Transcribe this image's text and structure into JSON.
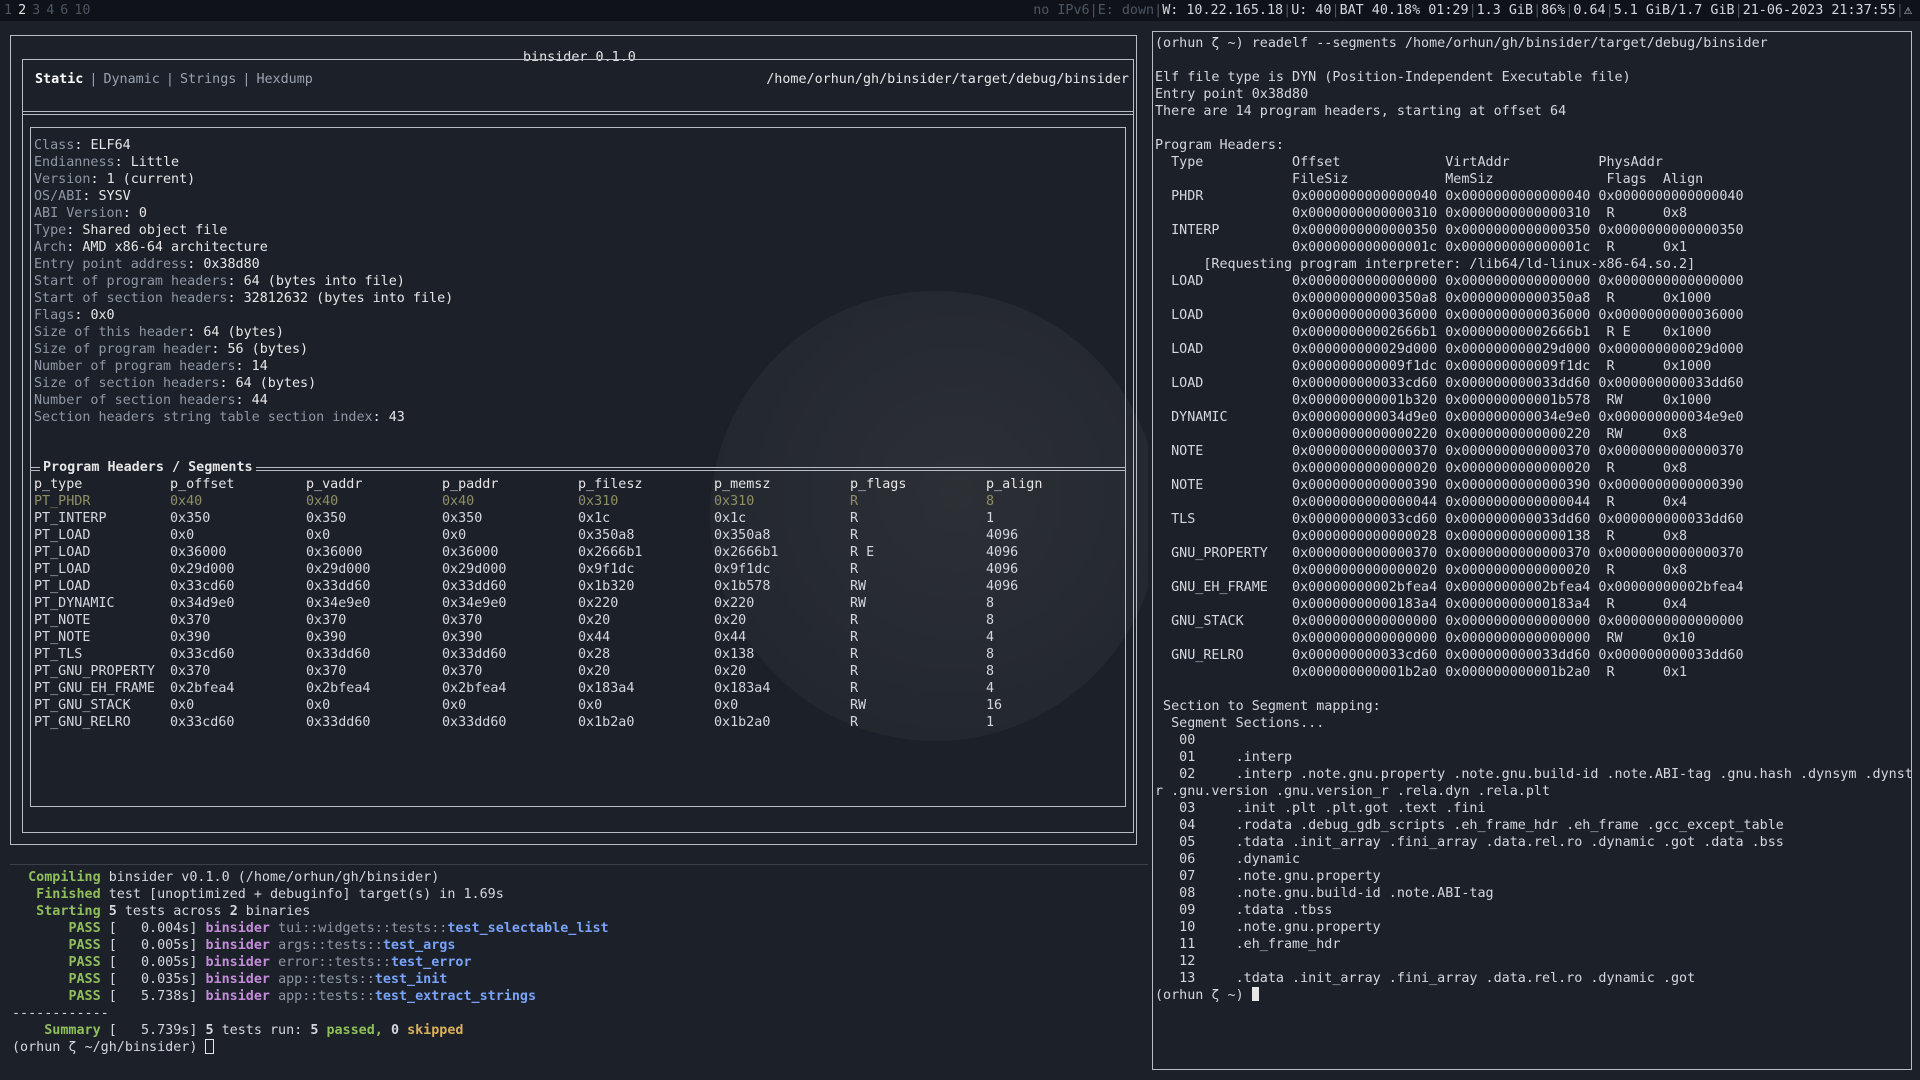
{
  "topbar": {
    "workspaces": [
      "1",
      "2",
      "3",
      "4",
      "6",
      "10"
    ],
    "active_workspace": "2",
    "status_dim": "no IPv6",
    "status_eth": "E: down",
    "status_wifi": "W: 10.22.165.18",
    "status_user": "U: 40",
    "status_bat": "BAT 40.18% 01:29",
    "status_disk": "1.3 GiB",
    "status_cpu": "86%",
    "status_load": "0.64",
    "status_mem": "5.1 GiB/1.7 GiB",
    "status_time": "21-06-2023 21:37:55",
    "status_end": "⚠"
  },
  "app": {
    "title": "binsider 0.1.0",
    "tabs": [
      "Static",
      "Dynamic",
      "Strings",
      "Hexdump"
    ],
    "active_tab": "Static",
    "path": "/home/orhun/gh/binsider/target/debug/binsider"
  },
  "header_info": [
    {
      "k": "Class",
      "v": "ELF64"
    },
    {
      "k": "Endianness",
      "v": "Little"
    },
    {
      "k": "Version",
      "v": "1 (current)"
    },
    {
      "k": "OS/ABI",
      "v": "SYSV"
    },
    {
      "k": "ABI Version",
      "v": "0"
    },
    {
      "k": "Type",
      "v": "Shared object file"
    },
    {
      "k": "Arch",
      "v": "AMD x86-64 architecture"
    },
    {
      "k": "Entry point address",
      "v": "0x38d80"
    },
    {
      "k": "Start of program headers",
      "v": "64 (bytes into file)"
    },
    {
      "k": "Start of section headers",
      "v": "32812632 (bytes into file)"
    },
    {
      "k": "Flags",
      "v": "0x0"
    },
    {
      "k": "Size of this header",
      "v": "64 (bytes)"
    },
    {
      "k": "Size of program header",
      "v": "56 (bytes)"
    },
    {
      "k": "Number of program headers",
      "v": "14"
    },
    {
      "k": "Size of section headers",
      "v": "64 (bytes)"
    },
    {
      "k": "Number of section headers",
      "v": "44"
    },
    {
      "k": "Section headers string table section index",
      "v": "43"
    }
  ],
  "program_headers": {
    "title": "Program Headers / Segments",
    "columns": [
      "p_type",
      "p_offset",
      "p_vaddr",
      "p_paddr",
      "p_filesz",
      "p_memsz",
      "p_flags",
      "p_align"
    ],
    "rows": [
      [
        "PT_PHDR",
        "0x40",
        "0x40",
        "0x40",
        "0x310",
        "0x310",
        "R",
        "8"
      ],
      [
        "PT_INTERP",
        "0x350",
        "0x350",
        "0x350",
        "0x1c",
        "0x1c",
        "R",
        "1"
      ],
      [
        "PT_LOAD",
        "0x0",
        "0x0",
        "0x0",
        "0x350a8",
        "0x350a8",
        "R",
        "4096"
      ],
      [
        "PT_LOAD",
        "0x36000",
        "0x36000",
        "0x36000",
        "0x2666b1",
        "0x2666b1",
        "R E",
        "4096"
      ],
      [
        "PT_LOAD",
        "0x29d000",
        "0x29d000",
        "0x29d000",
        "0x9f1dc",
        "0x9f1dc",
        "R",
        "4096"
      ],
      [
        "PT_LOAD",
        "0x33cd60",
        "0x33dd60",
        "0x33dd60",
        "0x1b320",
        "0x1b578",
        "RW",
        "4096"
      ],
      [
        "PT_DYNAMIC",
        "0x34d9e0",
        "0x34e9e0",
        "0x34e9e0",
        "0x220",
        "0x220",
        "RW",
        "8"
      ],
      [
        "PT_NOTE",
        "0x370",
        "0x370",
        "0x370",
        "0x20",
        "0x20",
        "R",
        "8"
      ],
      [
        "PT_NOTE",
        "0x390",
        "0x390",
        "0x390",
        "0x44",
        "0x44",
        "R",
        "4"
      ],
      [
        "PT_TLS",
        "0x33cd60",
        "0x33dd60",
        "0x33dd60",
        "0x28",
        "0x138",
        "R",
        "8"
      ],
      [
        "PT_GNU_PROPERTY",
        "0x370",
        "0x370",
        "0x370",
        "0x20",
        "0x20",
        "R",
        "8"
      ],
      [
        "PT_GNU_EH_FRAME",
        "0x2bfea4",
        "0x2bfea4",
        "0x2bfea4",
        "0x183a4",
        "0x183a4",
        "R",
        "4"
      ],
      [
        "PT_GNU_STACK",
        "0x0",
        "0x0",
        "0x0",
        "0x0",
        "0x0",
        "RW",
        "16"
      ],
      [
        "PT_GNU_RELRO",
        "0x33cd60",
        "0x33dd60",
        "0x33dd60",
        "0x1b2a0",
        "0x1b2a0",
        "R",
        "1"
      ]
    ]
  },
  "cargo": {
    "compiling_label": "Compiling",
    "compiling_text": "binsider v0.1.0 (/home/orhun/gh/binsider)",
    "finished_label": "Finished",
    "finished_text": "test [unoptimized + debuginfo] target(s) in 1.69s",
    "starting_label": "Starting",
    "starting_text": "5 tests across 2 binaries",
    "tests": [
      {
        "status": "PASS",
        "time": "[   0.004s]",
        "bin": "binsider",
        "path": "tui::widgets::tests::",
        "name": "test_selectable_list"
      },
      {
        "status": "PASS",
        "time": "[   0.005s]",
        "bin": "binsider",
        "path": "args::tests::",
        "name": "test_args"
      },
      {
        "status": "PASS",
        "time": "[   0.005s]",
        "bin": "binsider",
        "path": "error::tests::",
        "name": "test_error"
      },
      {
        "status": "PASS",
        "time": "[   0.035s]",
        "bin": "binsider",
        "path": "app::tests::",
        "name": "test_init"
      },
      {
        "status": "PASS",
        "time": "[   5.738s]",
        "bin": "binsider",
        "path": "app::tests::",
        "name": "test_extract_strings"
      }
    ],
    "separator": "------------",
    "summary_label": "Summary",
    "summary_time": "[   5.739s]",
    "summary_count": "5",
    "summary_mid": "tests run:",
    "summary_passed_n": "5",
    "summary_passed": "passed,",
    "summary_skipped_n": "0",
    "summary_skipped": "skipped",
    "prompt": "(orhun ζ ~/gh/binsider) "
  },
  "readelf": {
    "command": "(orhun ζ ~) readelf --segments /home/orhun/gh/binsider/target/debug/binsider",
    "body": "\nElf file type is DYN (Position-Independent Executable file)\nEntry point 0x38d80\nThere are 14 program headers, starting at offset 64\n\nProgram Headers:\n  Type           Offset             VirtAddr           PhysAddr\n                 FileSiz            MemSiz              Flags  Align\n  PHDR           0x0000000000000040 0x0000000000000040 0x0000000000000040\n                 0x0000000000000310 0x0000000000000310  R      0x8\n  INTERP         0x0000000000000350 0x0000000000000350 0x0000000000000350\n                 0x000000000000001c 0x000000000000001c  R      0x1\n      [Requesting program interpreter: /lib64/ld-linux-x86-64.so.2]\n  LOAD           0x0000000000000000 0x0000000000000000 0x0000000000000000\n                 0x00000000000350a8 0x00000000000350a8  R      0x1000\n  LOAD           0x0000000000036000 0x0000000000036000 0x0000000000036000\n                 0x00000000002666b1 0x00000000002666b1  R E    0x1000\n  LOAD           0x000000000029d000 0x000000000029d000 0x000000000029d000\n                 0x000000000009f1dc 0x000000000009f1dc  R      0x1000\n  LOAD           0x000000000033cd60 0x000000000033dd60 0x000000000033dd60\n                 0x000000000001b320 0x000000000001b578  RW     0x1000\n  DYNAMIC        0x000000000034d9e0 0x000000000034e9e0 0x000000000034e9e0\n                 0x0000000000000220 0x0000000000000220  RW     0x8\n  NOTE           0x0000000000000370 0x0000000000000370 0x0000000000000370\n                 0x0000000000000020 0x0000000000000020  R      0x8\n  NOTE           0x0000000000000390 0x0000000000000390 0x0000000000000390\n                 0x0000000000000044 0x0000000000000044  R      0x4\n  TLS            0x000000000033cd60 0x000000000033dd60 0x000000000033dd60\n                 0x0000000000000028 0x0000000000000138  R      0x8\n  GNU_PROPERTY   0x0000000000000370 0x0000000000000370 0x0000000000000370\n                 0x0000000000000020 0x0000000000000020  R      0x8\n  GNU_EH_FRAME   0x00000000002bfea4 0x00000000002bfea4 0x00000000002bfea4\n                 0x00000000000183a4 0x00000000000183a4  R      0x4\n  GNU_STACK      0x0000000000000000 0x0000000000000000 0x0000000000000000\n                 0x0000000000000000 0x0000000000000000  RW     0x10\n  GNU_RELRO      0x000000000033cd60 0x000000000033dd60 0x000000000033dd60\n                 0x000000000001b2a0 0x000000000001b2a0  R      0x1\n\n Section to Segment mapping:\n  Segment Sections...\n   00     \n   01     .interp \n   02     .interp .note.gnu.property .note.gnu.build-id .note.ABI-tag .gnu.hash .dynsym .dynst\nr .gnu.version .gnu.version_r .rela.dyn .rela.plt \n   03     .init .plt .plt.got .text .fini \n   04     .rodata .debug_gdb_scripts .eh_frame_hdr .eh_frame .gcc_except_table \n   05     .tdata .init_array .fini_array .data.rel.ro .dynamic .got .data .bss \n   06     .dynamic \n   07     .note.gnu.property \n   08     .note.gnu.build-id .note.ABI-tag \n   09     .tdata .tbss \n   10     .note.gnu.property \n   11     .eh_frame_hdr \n   12     \n   13     .tdata .init_array .fini_array .data.rel.ro .dynamic .got ",
    "prompt": "(orhun ζ ~) "
  }
}
